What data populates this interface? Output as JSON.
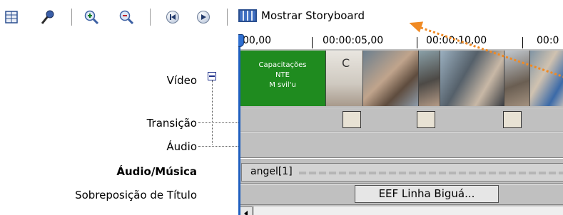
{
  "toolbar": {
    "icons": [
      "storyboard-grid-icon",
      "narrate-microphone-icon",
      "zoom-in-icon",
      "zoom-out-icon",
      "rewind-icon",
      "play-icon"
    ],
    "storyboard_label": "Mostrar Storyboard"
  },
  "tracks": {
    "video": "Vídeo",
    "transition": "Transição",
    "audio": "Áudio",
    "audio_music": "Áudio/Música",
    "title_overlay": "Sobreposição de Título"
  },
  "ruler": {
    "ticks": [
      "00,00",
      "00:00:05,00",
      "00:00:10,00",
      "00:0"
    ]
  },
  "clips": {
    "title_clip_lines": [
      "Capacitações",
      "NTE",
      "M  svil'u"
    ],
    "second_clip_letter": "C",
    "audio_clip": "angel[1]",
    "title_overlay_clip": "EEF Linha Biguá..."
  },
  "colors": {
    "title_clip_bg": "#1f8b1f",
    "arrow": "#f08a24",
    "timeline_bg": "#c0c0c0",
    "playhead": "#1f5fbf"
  }
}
